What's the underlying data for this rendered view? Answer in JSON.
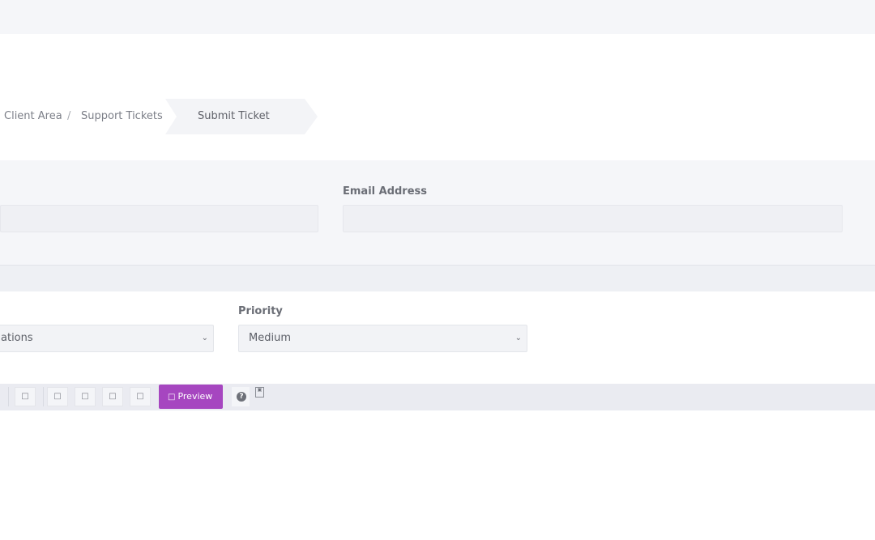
{
  "breadcrumb": {
    "items": [
      "Client Area",
      "Support Tickets"
    ],
    "separator": "/",
    "active": "Submit Ticket"
  },
  "form": {
    "email_label": "Email Address",
    "email_value": "",
    "priority_label": "Priority",
    "department_value": "ations",
    "priority_value": "Medium"
  },
  "toolbar": {
    "button_glyph": "□",
    "preview_label": "Preview",
    "help_glyph": "?",
    "icons": [
      "square-icon",
      "square-icon",
      "square-icon",
      "square-icon",
      "square-icon",
      "help-icon",
      "markdown-icon"
    ]
  },
  "colors": {
    "accent": "#a646c0",
    "panel_bg": "#f5f6f9",
    "toolbar_bg": "#eaebf1"
  }
}
